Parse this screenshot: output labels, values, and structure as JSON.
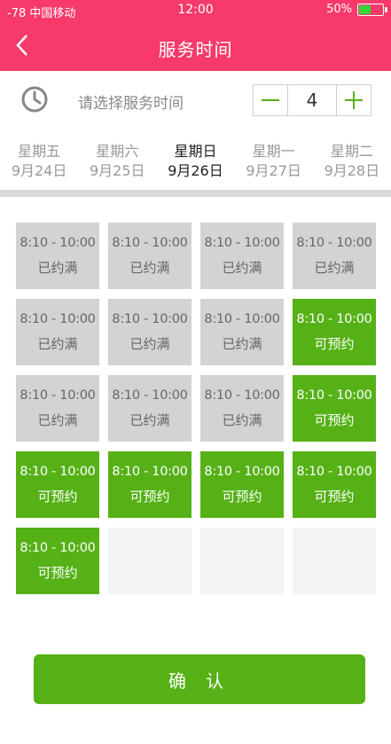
{
  "status_bar": {
    "signal": "-78",
    "carrier": "中国移动",
    "time": "12:00",
    "battery_text": "50%",
    "battery_level": 0.5
  },
  "header": {
    "title": "服务时间",
    "back_icon": "chevron-left-icon"
  },
  "time_select": {
    "icon": "clock-icon",
    "prompt": "请选择服务时间",
    "quantity": "4"
  },
  "days": [
    {
      "weekday": "星期五",
      "date": "9月24日",
      "active": false
    },
    {
      "weekday": "星期六",
      "date": "9月25日",
      "active": false
    },
    {
      "weekday": "星期日",
      "date": "9月26日",
      "active": true
    },
    {
      "weekday": "星期一",
      "date": "9月27日",
      "active": false
    },
    {
      "weekday": "星期二",
      "date": "9月28日",
      "active": false
    }
  ],
  "slots": [
    {
      "time": "8:10 - 10:00",
      "status": "已约满",
      "kind": "full"
    },
    {
      "time": "8:10 - 10:00",
      "status": "已约满",
      "kind": "full"
    },
    {
      "time": "8:10 - 10:00",
      "status": "已约满",
      "kind": "full"
    },
    {
      "time": "8:10 - 10:00",
      "status": "已约满",
      "kind": "full"
    },
    {
      "time": "8:10 - 10:00",
      "status": "已约满",
      "kind": "full"
    },
    {
      "time": "8:10 - 10:00",
      "status": "已约满",
      "kind": "full"
    },
    {
      "time": "8:10 - 10:00",
      "status": "已约满",
      "kind": "full"
    },
    {
      "time": "8:10 - 10:00",
      "status": "可预约",
      "kind": "avail"
    },
    {
      "time": "8:10 - 10:00",
      "status": "已约满",
      "kind": "full"
    },
    {
      "time": "8:10 - 10:00",
      "status": "已约满",
      "kind": "full"
    },
    {
      "time": "8:10 - 10:00",
      "status": "已约满",
      "kind": "full"
    },
    {
      "time": "8:10 - 10:00",
      "status": "可预约",
      "kind": "avail"
    },
    {
      "time": "8:10 - 10:00",
      "status": "可预约",
      "kind": "avail"
    },
    {
      "time": "8:10 - 10:00",
      "status": "可预约",
      "kind": "avail"
    },
    {
      "time": "8:10 - 10:00",
      "status": "可预约",
      "kind": "avail"
    },
    {
      "time": "8:10 - 10:00",
      "status": "可预约",
      "kind": "avail"
    },
    {
      "time": "8:10 - 10:00",
      "status": "可预约",
      "kind": "avail"
    },
    {
      "time": "",
      "status": "",
      "kind": "empty"
    },
    {
      "time": "",
      "status": "",
      "kind": "empty"
    },
    {
      "time": "",
      "status": "",
      "kind": "empty"
    }
  ],
  "confirm_label": "确 认",
  "colors": {
    "header": "#f73a6a",
    "available": "#55b116",
    "full": "#d3d3d3",
    "empty": "#f3f3f3"
  }
}
